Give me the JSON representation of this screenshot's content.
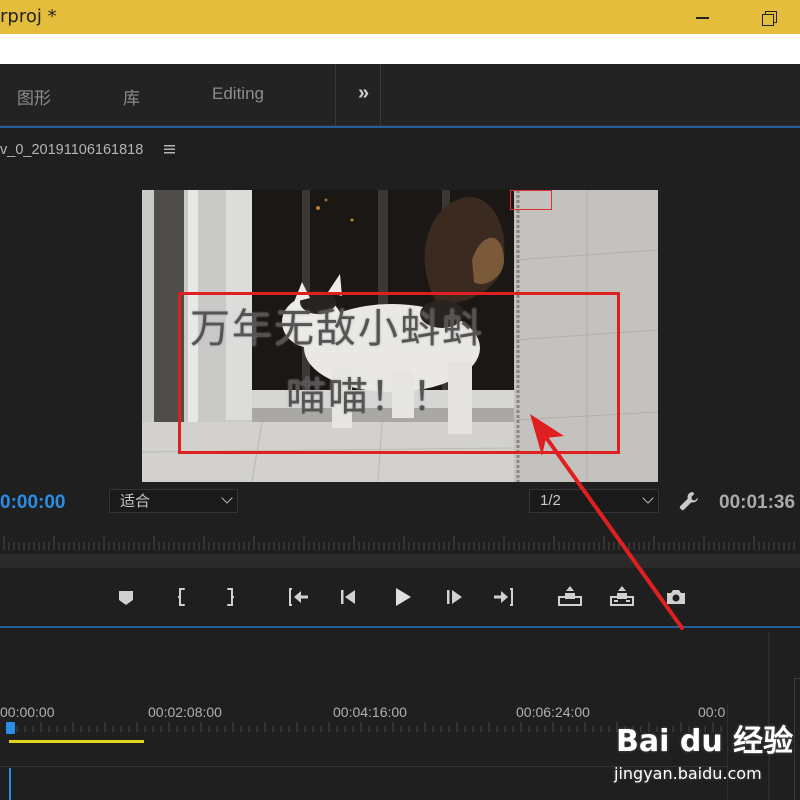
{
  "window": {
    "title": "rproj *"
  },
  "workspace_tabs": [
    {
      "label": "图形"
    },
    {
      "label": "库"
    },
    {
      "label": "Editing"
    }
  ],
  "workspace_more_icon": "double-chevron-right-icon",
  "monitor": {
    "sequence_name": "v_0_20191106161818",
    "menu_icon": "hamburger-icon",
    "overlay_title_line1": "万年无敌小蚪蚪",
    "overlay_title_line2": "喵喵！！",
    "current_timecode": "0:00:00",
    "fit_label": "适合",
    "resolution_label": "1/2",
    "duration_timecode": "00:01:36",
    "accent_color": "#2b8ce6",
    "annotation_color": "#e02020"
  },
  "transport": [
    {
      "name": "add-marker",
      "icon": "marker-icon"
    },
    {
      "name": "mark-in",
      "icon": "mark-in-icon"
    },
    {
      "name": "mark-out",
      "icon": "mark-out-icon"
    },
    {
      "name": "go-to-in",
      "icon": "go-to-in-icon"
    },
    {
      "name": "step-back",
      "icon": "step-back-icon"
    },
    {
      "name": "play",
      "icon": "play-icon"
    },
    {
      "name": "step-forward",
      "icon": "step-forward-icon"
    },
    {
      "name": "go-to-out",
      "icon": "go-to-out-icon"
    },
    {
      "name": "lift",
      "icon": "lift-icon"
    },
    {
      "name": "extract",
      "icon": "extract-icon"
    },
    {
      "name": "export-frame",
      "icon": "camera-icon"
    }
  ],
  "timeline": {
    "ruler_labels": [
      "00:00:00",
      "00:02:08:00",
      "00:04:16:00",
      "00:06:24:00",
      "00:0"
    ],
    "work_area_color": "#e3d51e"
  },
  "watermark": {
    "logo": "Bai du 经验",
    "url": "jingyan.baidu.com"
  }
}
